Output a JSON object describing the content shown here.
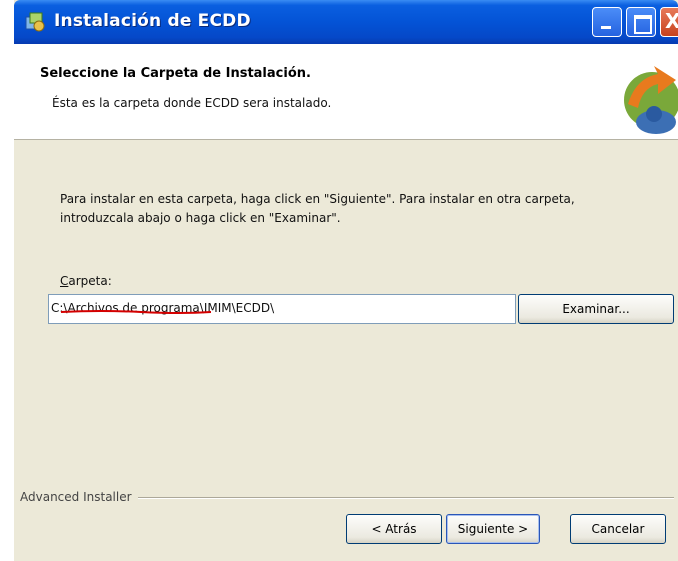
{
  "window": {
    "title": "Instalación de ECDD",
    "controls": {
      "minimize_icon": "minimize-icon",
      "maximize_icon": "maximize-icon",
      "close_label": "X"
    }
  },
  "banner": {
    "title": "Seleccione la Carpeta de Instalación.",
    "subtitle": "Ésta es la carpeta donde ECDD sera instalado.",
    "logo_icon": "installer-logo-icon"
  },
  "content": {
    "instructions_line1": "Para instalar en esta carpeta, haga click en \"Siguiente\". Para instalar en otra carpeta,",
    "instructions_line2": "introduzcala abajo o haga click en \"Examinar\"."
  },
  "folder": {
    "label_first": "C",
    "label_rest": "arpeta:",
    "value": "C:\\Archivos de programa\\IMIM\\ECDD\\",
    "browse_label": "Examinar..."
  },
  "footer": {
    "brand": "Advanced Installer",
    "back_label": "< Atrás",
    "next_label": "Siguiente >",
    "cancel_label": "Cancelar"
  },
  "colors": {
    "titlebar": "#0453d6",
    "dialog_bg": "#ece9d8",
    "close_button": "#c8421e",
    "annotation_red": "#d40000"
  }
}
